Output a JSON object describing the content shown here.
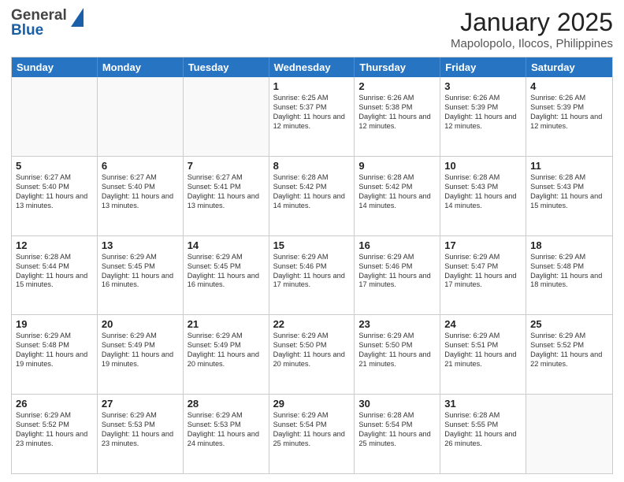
{
  "logo": {
    "general": "General",
    "blue": "Blue"
  },
  "header": {
    "month": "January 2025",
    "location": "Mapolopolo, Ilocos, Philippines"
  },
  "days": [
    "Sunday",
    "Monday",
    "Tuesday",
    "Wednesday",
    "Thursday",
    "Friday",
    "Saturday"
  ],
  "weeks": [
    [
      {
        "date": "",
        "sunrise": "",
        "sunset": "",
        "daylight": ""
      },
      {
        "date": "",
        "sunrise": "",
        "sunset": "",
        "daylight": ""
      },
      {
        "date": "",
        "sunrise": "",
        "sunset": "",
        "daylight": ""
      },
      {
        "date": "1",
        "sunrise": "Sunrise: 6:25 AM",
        "sunset": "Sunset: 5:37 PM",
        "daylight": "Daylight: 11 hours and 12 minutes."
      },
      {
        "date": "2",
        "sunrise": "Sunrise: 6:26 AM",
        "sunset": "Sunset: 5:38 PM",
        "daylight": "Daylight: 11 hours and 12 minutes."
      },
      {
        "date": "3",
        "sunrise": "Sunrise: 6:26 AM",
        "sunset": "Sunset: 5:39 PM",
        "daylight": "Daylight: 11 hours and 12 minutes."
      },
      {
        "date": "4",
        "sunrise": "Sunrise: 6:26 AM",
        "sunset": "Sunset: 5:39 PM",
        "daylight": "Daylight: 11 hours and 12 minutes."
      }
    ],
    [
      {
        "date": "5",
        "sunrise": "Sunrise: 6:27 AM",
        "sunset": "Sunset: 5:40 PM",
        "daylight": "Daylight: 11 hours and 13 minutes."
      },
      {
        "date": "6",
        "sunrise": "Sunrise: 6:27 AM",
        "sunset": "Sunset: 5:40 PM",
        "daylight": "Daylight: 11 hours and 13 minutes."
      },
      {
        "date": "7",
        "sunrise": "Sunrise: 6:27 AM",
        "sunset": "Sunset: 5:41 PM",
        "daylight": "Daylight: 11 hours and 13 minutes."
      },
      {
        "date": "8",
        "sunrise": "Sunrise: 6:28 AM",
        "sunset": "Sunset: 5:42 PM",
        "daylight": "Daylight: 11 hours and 14 minutes."
      },
      {
        "date": "9",
        "sunrise": "Sunrise: 6:28 AM",
        "sunset": "Sunset: 5:42 PM",
        "daylight": "Daylight: 11 hours and 14 minutes."
      },
      {
        "date": "10",
        "sunrise": "Sunrise: 6:28 AM",
        "sunset": "Sunset: 5:43 PM",
        "daylight": "Daylight: 11 hours and 14 minutes."
      },
      {
        "date": "11",
        "sunrise": "Sunrise: 6:28 AM",
        "sunset": "Sunset: 5:43 PM",
        "daylight": "Daylight: 11 hours and 15 minutes."
      }
    ],
    [
      {
        "date": "12",
        "sunrise": "Sunrise: 6:28 AM",
        "sunset": "Sunset: 5:44 PM",
        "daylight": "Daylight: 11 hours and 15 minutes."
      },
      {
        "date": "13",
        "sunrise": "Sunrise: 6:29 AM",
        "sunset": "Sunset: 5:45 PM",
        "daylight": "Daylight: 11 hours and 16 minutes."
      },
      {
        "date": "14",
        "sunrise": "Sunrise: 6:29 AM",
        "sunset": "Sunset: 5:45 PM",
        "daylight": "Daylight: 11 hours and 16 minutes."
      },
      {
        "date": "15",
        "sunrise": "Sunrise: 6:29 AM",
        "sunset": "Sunset: 5:46 PM",
        "daylight": "Daylight: 11 hours and 17 minutes."
      },
      {
        "date": "16",
        "sunrise": "Sunrise: 6:29 AM",
        "sunset": "Sunset: 5:46 PM",
        "daylight": "Daylight: 11 hours and 17 minutes."
      },
      {
        "date": "17",
        "sunrise": "Sunrise: 6:29 AM",
        "sunset": "Sunset: 5:47 PM",
        "daylight": "Daylight: 11 hours and 17 minutes."
      },
      {
        "date": "18",
        "sunrise": "Sunrise: 6:29 AM",
        "sunset": "Sunset: 5:48 PM",
        "daylight": "Daylight: 11 hours and 18 minutes."
      }
    ],
    [
      {
        "date": "19",
        "sunrise": "Sunrise: 6:29 AM",
        "sunset": "Sunset: 5:48 PM",
        "daylight": "Daylight: 11 hours and 19 minutes."
      },
      {
        "date": "20",
        "sunrise": "Sunrise: 6:29 AM",
        "sunset": "Sunset: 5:49 PM",
        "daylight": "Daylight: 11 hours and 19 minutes."
      },
      {
        "date": "21",
        "sunrise": "Sunrise: 6:29 AM",
        "sunset": "Sunset: 5:49 PM",
        "daylight": "Daylight: 11 hours and 20 minutes."
      },
      {
        "date": "22",
        "sunrise": "Sunrise: 6:29 AM",
        "sunset": "Sunset: 5:50 PM",
        "daylight": "Daylight: 11 hours and 20 minutes."
      },
      {
        "date": "23",
        "sunrise": "Sunrise: 6:29 AM",
        "sunset": "Sunset: 5:50 PM",
        "daylight": "Daylight: 11 hours and 21 minutes."
      },
      {
        "date": "24",
        "sunrise": "Sunrise: 6:29 AM",
        "sunset": "Sunset: 5:51 PM",
        "daylight": "Daylight: 11 hours and 21 minutes."
      },
      {
        "date": "25",
        "sunrise": "Sunrise: 6:29 AM",
        "sunset": "Sunset: 5:52 PM",
        "daylight": "Daylight: 11 hours and 22 minutes."
      }
    ],
    [
      {
        "date": "26",
        "sunrise": "Sunrise: 6:29 AM",
        "sunset": "Sunset: 5:52 PM",
        "daylight": "Daylight: 11 hours and 23 minutes."
      },
      {
        "date": "27",
        "sunrise": "Sunrise: 6:29 AM",
        "sunset": "Sunset: 5:53 PM",
        "daylight": "Daylight: 11 hours and 23 minutes."
      },
      {
        "date": "28",
        "sunrise": "Sunrise: 6:29 AM",
        "sunset": "Sunset: 5:53 PM",
        "daylight": "Daylight: 11 hours and 24 minutes."
      },
      {
        "date": "29",
        "sunrise": "Sunrise: 6:29 AM",
        "sunset": "Sunset: 5:54 PM",
        "daylight": "Daylight: 11 hours and 25 minutes."
      },
      {
        "date": "30",
        "sunrise": "Sunrise: 6:28 AM",
        "sunset": "Sunset: 5:54 PM",
        "daylight": "Daylight: 11 hours and 25 minutes."
      },
      {
        "date": "31",
        "sunrise": "Sunrise: 6:28 AM",
        "sunset": "Sunset: 5:55 PM",
        "daylight": "Daylight: 11 hours and 26 minutes."
      },
      {
        "date": "",
        "sunrise": "",
        "sunset": "",
        "daylight": ""
      }
    ]
  ]
}
